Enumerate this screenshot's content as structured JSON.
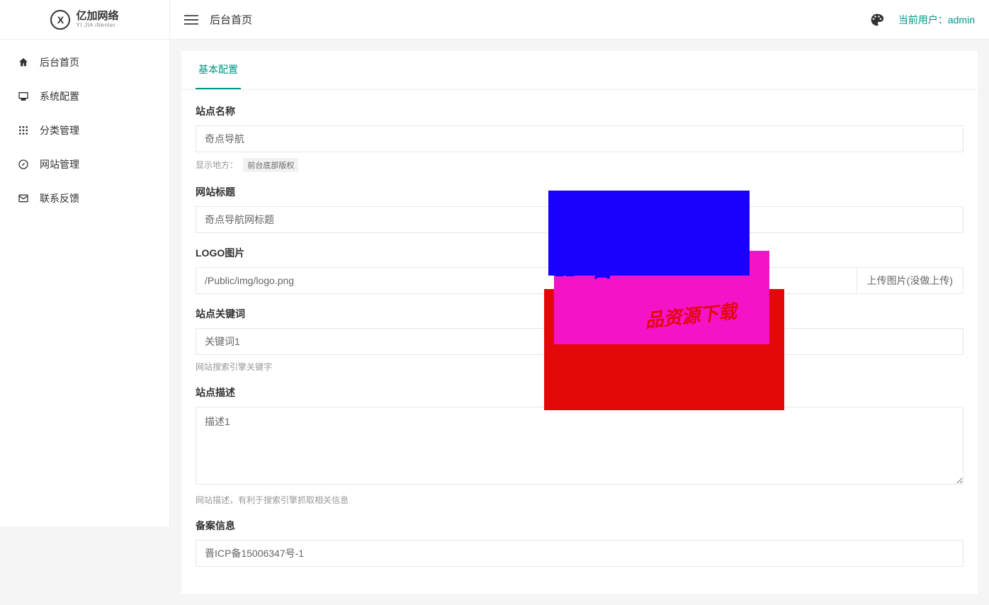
{
  "brand": {
    "name": "亿加网络",
    "sub": "YI JIA iNenter",
    "mark": "X"
  },
  "header": {
    "breadcrumb": "后台首页",
    "user_label": "当前用户：",
    "user_name": "admin"
  },
  "sidebar": {
    "items": [
      {
        "id": "home",
        "label": "后台首页"
      },
      {
        "id": "config",
        "label": "系统配置"
      },
      {
        "id": "category",
        "label": "分类管理"
      },
      {
        "id": "website",
        "label": "网站管理"
      },
      {
        "id": "feedback",
        "label": "联系反馈"
      }
    ]
  },
  "tabs": [
    {
      "label": "基本配置",
      "active": true
    }
  ],
  "form": {
    "site_name": {
      "label": "站点名称",
      "value": "奇点导航",
      "help_prefix": "显示地方：",
      "help_tag": "前台底部版权"
    },
    "site_title": {
      "label": "网站标题",
      "value": "奇点导航网标题"
    },
    "logo": {
      "label": "LOGO图片",
      "value": "/Public/img/logo.png",
      "button": "上传图片(没做上传)"
    },
    "keywords": {
      "label": "站点关键词",
      "value": "关键词1",
      "help": "网站搜索引擎关键字"
    },
    "description": {
      "label": "站点描述",
      "value": "描述1",
      "help": "网站描述，有利于搜索引擎抓取相关信息"
    },
    "icp": {
      "label": "备案信息",
      "value": "晋ICP备15006347号-1"
    }
  },
  "overlay": {
    "text1": "H-墙",
    "text2": "品资源下载"
  }
}
